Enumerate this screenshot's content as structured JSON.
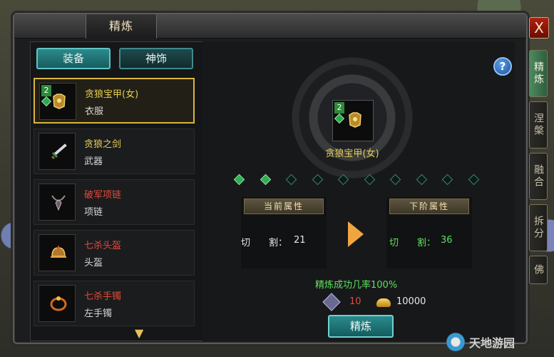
{
  "window": {
    "title": "精炼",
    "close": "X"
  },
  "category_tabs": [
    "装备",
    "神饰"
  ],
  "items": [
    {
      "name": "贪狼宝甲(女)",
      "type": "衣服",
      "selected": true,
      "name_color": "gold",
      "level": "2",
      "icon": "armor-icon"
    },
    {
      "name": "贪狼之剑",
      "type": "武器",
      "selected": false,
      "name_color": "gold",
      "icon": "sword-icon"
    },
    {
      "name": "破军项链",
      "type": "项链",
      "selected": false,
      "name_color": "red",
      "icon": "necklace-icon"
    },
    {
      "name": "七杀头盔",
      "type": "头盔",
      "selected": false,
      "name_color": "red",
      "icon": "helmet-icon"
    },
    {
      "name": "七杀手镯",
      "type": "左手镯",
      "selected": false,
      "name_color": "red",
      "icon": "bracelet-icon"
    }
  ],
  "help": "?",
  "center": {
    "level": "2",
    "name": "贪狼宝甲(女)"
  },
  "refine_level": {
    "filled": 2,
    "total": 10
  },
  "current_attr": {
    "title": "当前属性",
    "label": "切　　割：",
    "value": "21"
  },
  "next_attr": {
    "title": "下阶属性",
    "label": "切　　割：",
    "value": "36"
  },
  "success_rate": "精炼成功几率100%",
  "cost": {
    "crystal": "10",
    "gold": "10000"
  },
  "refine_button": "精炼",
  "side_tabs": [
    "精炼",
    "涅槃",
    "融合",
    "拆分",
    "佛"
  ],
  "watermark": "天地游园"
}
